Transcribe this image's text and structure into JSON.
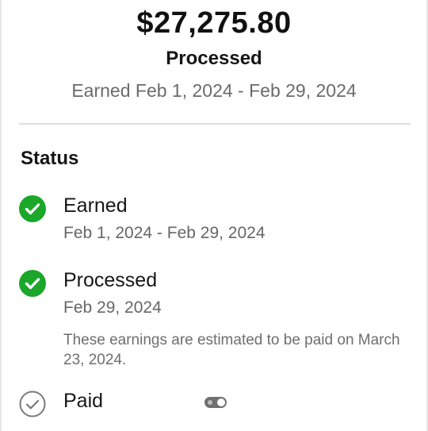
{
  "summary": {
    "amount": "$27,275.80",
    "status": "Processed",
    "period": "Earned Feb 1, 2024 - Feb 29, 2024"
  },
  "status_section": {
    "title": "Status",
    "steps": [
      {
        "title": "Earned",
        "date": "Feb 1, 2024 - Feb 29, 2024",
        "state": "complete",
        "icon": "check-circle-icon"
      },
      {
        "title": "Processed",
        "date": "Feb 29, 2024",
        "note": "These earnings are estimated to be paid on March 23, 2024.",
        "state": "complete",
        "icon": "check-circle-icon"
      },
      {
        "title": "Paid",
        "state": "pending",
        "icon": "check-circle-outline-icon"
      }
    ]
  },
  "colors": {
    "success": "#1aa72a",
    "pending": "#7a7a7a",
    "text_primary": "#151515",
    "text_secondary": "#666666"
  }
}
